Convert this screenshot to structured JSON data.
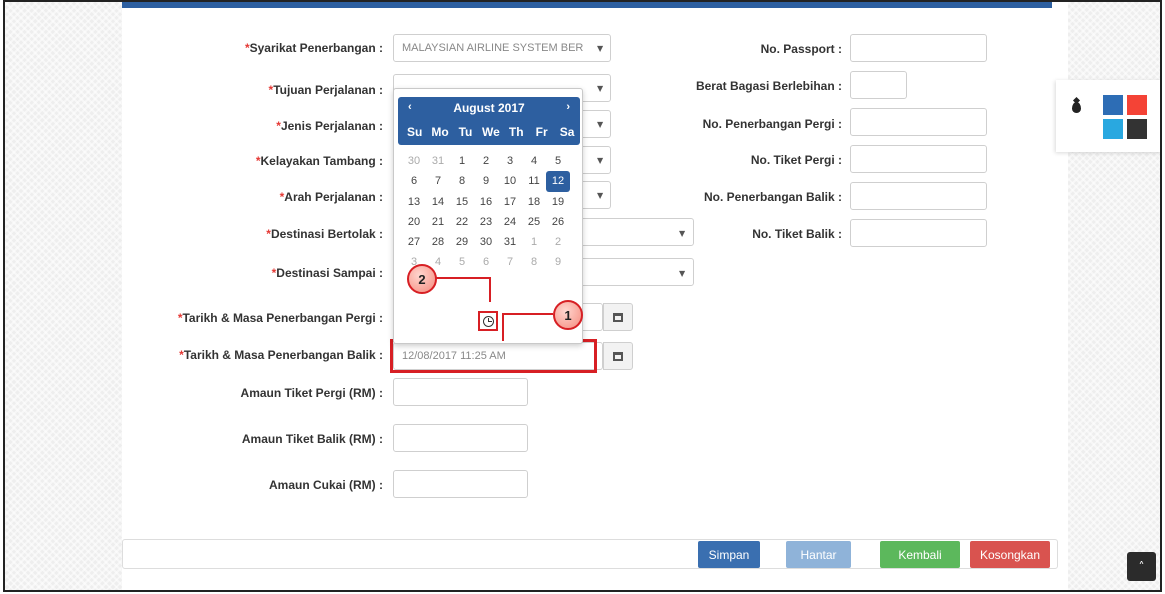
{
  "form": {
    "left_fields": [
      {
        "label": "Syarikat Penerbangan :",
        "required": true,
        "value": "MALAYSIAN AIRLINE SYSTEM BER",
        "type": "select"
      },
      {
        "label": "Tujuan Perjalanan :",
        "required": true,
        "value": "",
        "type": "select"
      },
      {
        "label": "Jenis Perjalanan :",
        "required": true,
        "value": "",
        "type": "select"
      },
      {
        "label": "Kelayakan Tambang :",
        "required": true,
        "value": "",
        "type": "select"
      },
      {
        "label": "Arah Perjalanan :",
        "required": true,
        "value": "",
        "type": "select"
      },
      {
        "label": "Destinasi Bertolak :",
        "required": true,
        "value": "",
        "type": "select"
      },
      {
        "label": "Destinasi Sampai :",
        "required": true,
        "value": "",
        "type": "select"
      },
      {
        "label": "Tarikh & Masa Penerbangan Pergi :",
        "required": true,
        "value": "",
        "type": "datetime"
      },
      {
        "label": "Tarikh & Masa Penerbangan Balik :",
        "required": true,
        "value": "12/08/2017 11:25 AM",
        "type": "datetime"
      },
      {
        "label": "Amaun Tiket Pergi (RM) :",
        "required": false,
        "value": "",
        "type": "text"
      },
      {
        "label": "Amaun Tiket Balik (RM) :",
        "required": false,
        "value": "",
        "type": "text"
      },
      {
        "label": "Amaun Cukai (RM) :",
        "required": false,
        "value": "",
        "type": "text"
      }
    ],
    "right_fields": [
      {
        "label": "No. Passport :",
        "value": ""
      },
      {
        "label": "Berat Bagasi Berlebihan :",
        "value": ""
      },
      {
        "label": "No. Penerbangan Pergi :",
        "value": ""
      },
      {
        "label": "No. Tiket Pergi :",
        "value": ""
      },
      {
        "label": "No. Penerbangan Balik :",
        "value": ""
      },
      {
        "label": "No. Tiket Balik :",
        "value": ""
      }
    ]
  },
  "datepicker": {
    "month_title": "August 2017",
    "prev": "‹",
    "next": "›",
    "weekdays": [
      "Su",
      "Mo",
      "Tu",
      "We",
      "Th",
      "Fr",
      "Sa"
    ],
    "weeks": [
      [
        "30",
        "31",
        "1",
        "2",
        "3",
        "4",
        "5"
      ],
      [
        "6",
        "7",
        "8",
        "9",
        "10",
        "11",
        "12"
      ],
      [
        "13",
        "14",
        "15",
        "16",
        "17",
        "18",
        "19"
      ],
      [
        "20",
        "21",
        "22",
        "23",
        "24",
        "25",
        "26"
      ],
      [
        "27",
        "28",
        "29",
        "30",
        "31",
        "1",
        "2"
      ],
      [
        "3",
        "4",
        "5",
        "6",
        "7",
        "8",
        "9"
      ]
    ],
    "selected_day": "12"
  },
  "annotations": {
    "marker_1": "1",
    "marker_2": "2"
  },
  "buttons": {
    "simpan": "Simpan",
    "hantar": "Hantar",
    "kembali": "Kembali",
    "kosongkan": "Kosongkan"
  },
  "colors": {
    "primary": "#2d5fa0",
    "required": "#e53935",
    "highlight": "#d71f24",
    "simpan": "#3a6fb0",
    "hantar": "#8fb3d9",
    "kembali": "#5cb85c",
    "kosongkan": "#d9534f",
    "swatches": [
      "#2d6db5",
      "#f44336",
      "#29a8e0",
      "#333333"
    ]
  },
  "icons": {
    "calendar": "calendar-icon",
    "clock": "clock-icon",
    "theme": "droplet-icon",
    "scroll_top": "chevron-up-icon"
  },
  "scroll_top_glyph": "˄"
}
